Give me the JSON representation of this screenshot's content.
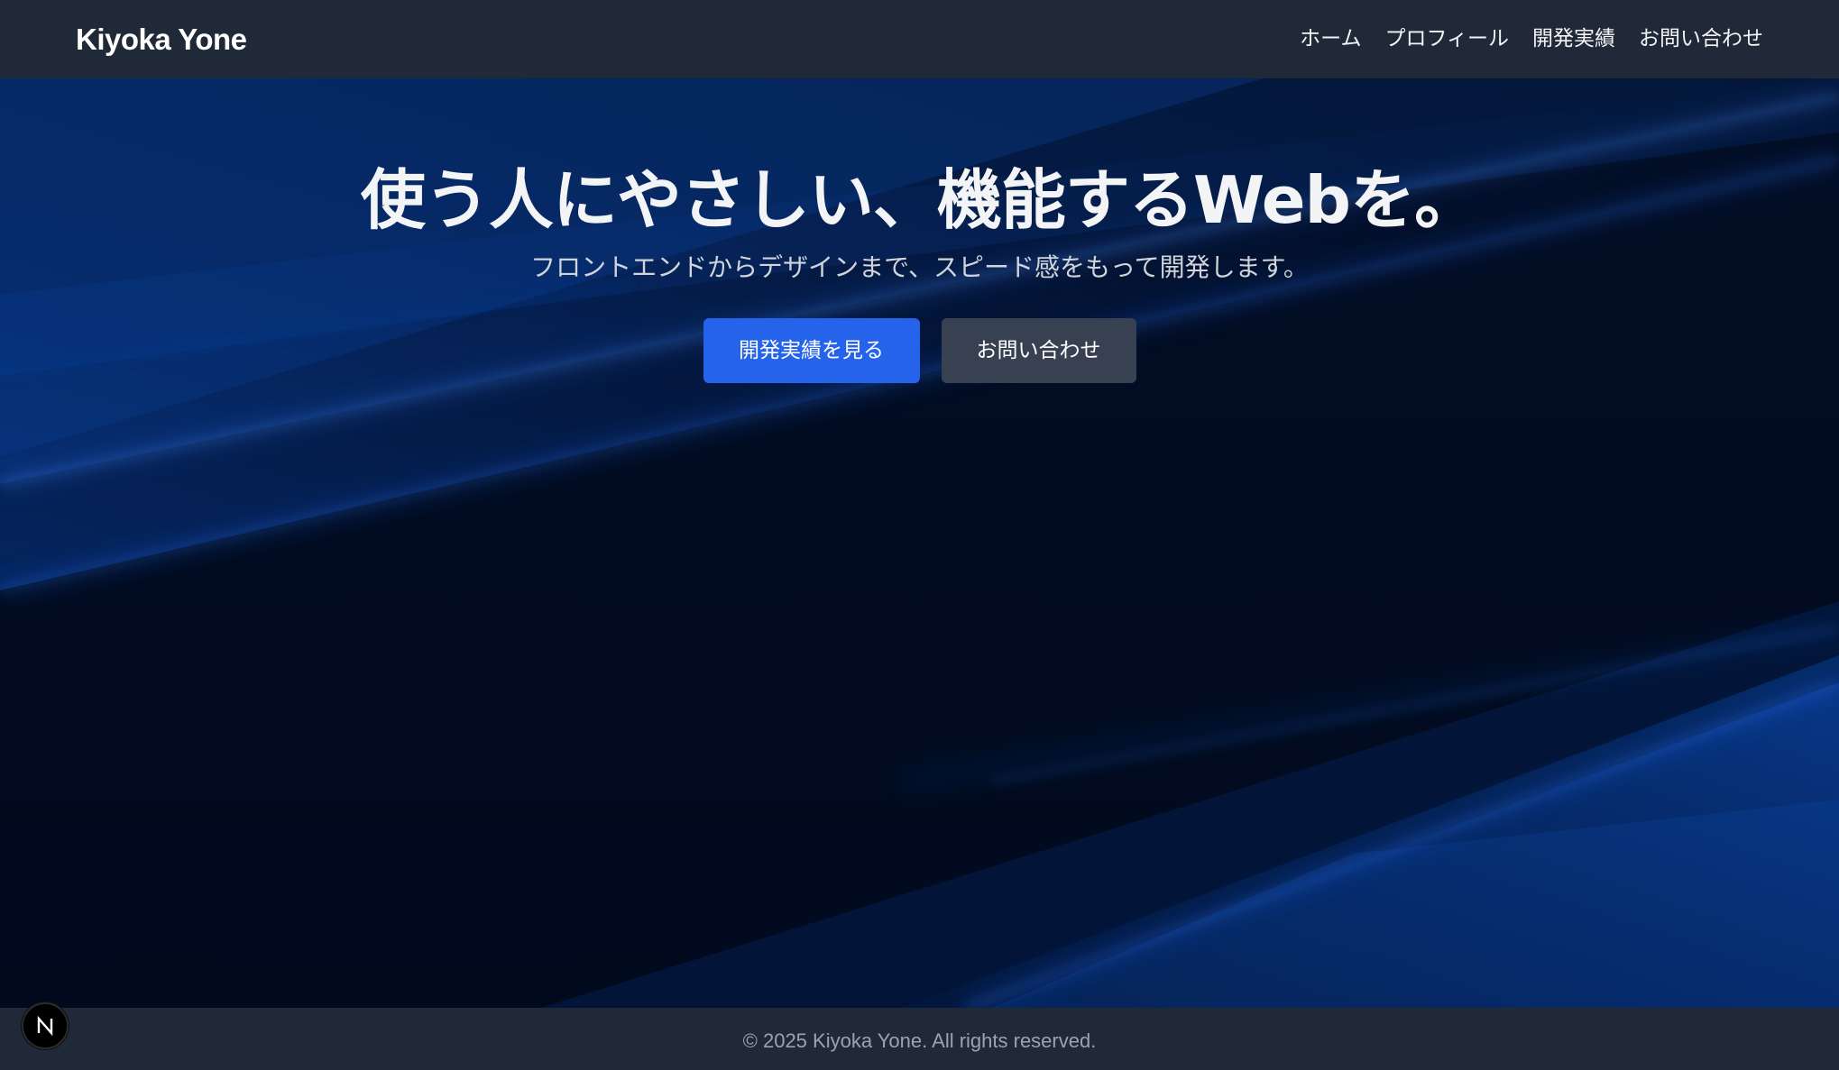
{
  "header": {
    "brand": "Kiyoka Yone",
    "nav": [
      {
        "label": "ホーム"
      },
      {
        "label": "プロフィール"
      },
      {
        "label": "開発実績"
      },
      {
        "label": "お問い合わせ"
      }
    ]
  },
  "hero": {
    "title": "使う人にやさしい、機能するWebを。",
    "subtitle": "フロントエンドからデザインまで、スピード感をもって開発します。",
    "primary_button": "開発実績を見る",
    "secondary_button": "お問い合わせ"
  },
  "footer": {
    "copyright": "© 2025 Kiyoka Yone. All rights reserved."
  },
  "dev_badge": {
    "icon": "nextjs-logo-icon"
  },
  "colors": {
    "header_bg": "#1f2937",
    "hero_bg": "#020b1f",
    "accent_blue": "#2563eb",
    "secondary_button": "#374151",
    "footer_text": "#9ca3af"
  }
}
